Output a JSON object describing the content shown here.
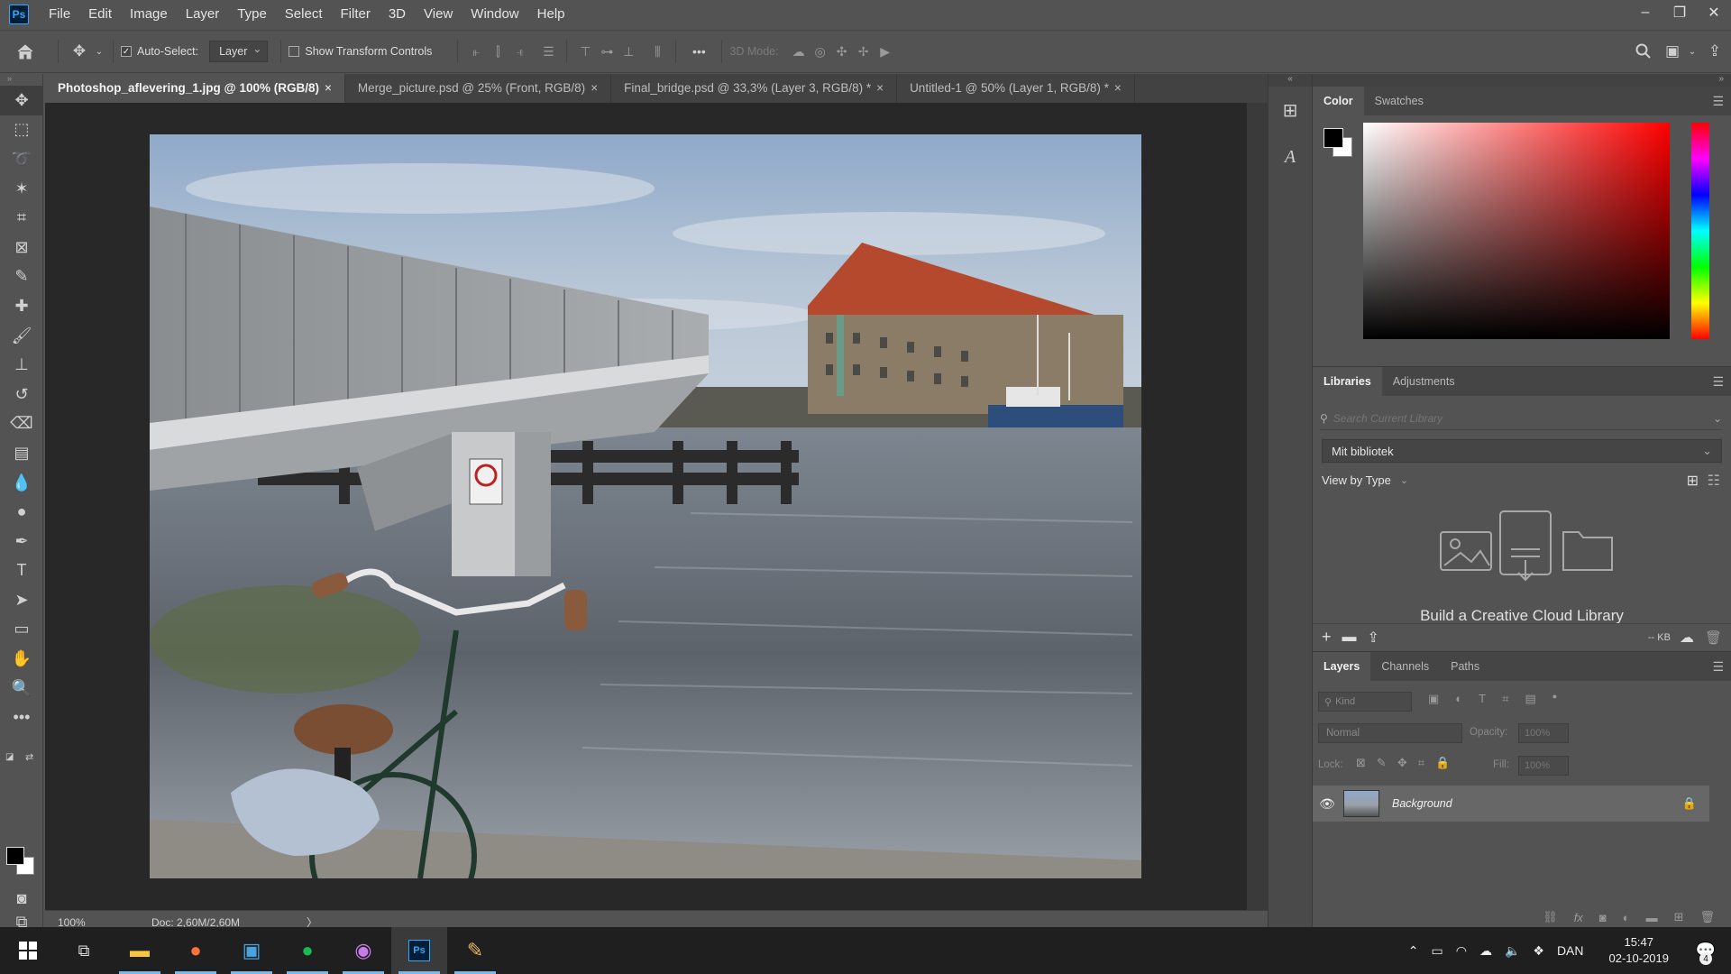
{
  "app": {
    "logo": "Ps"
  },
  "menu": [
    "File",
    "Edit",
    "Image",
    "Layer",
    "Type",
    "Select",
    "Filter",
    "3D",
    "View",
    "Window",
    "Help"
  ],
  "window_controls": {
    "minimize": "–",
    "restore": "❐",
    "close": "✕"
  },
  "options": {
    "auto_select_label": "Auto-Select:",
    "auto_select_checked": true,
    "layer_dropdown": "Layer",
    "transform_label": "Show Transform Controls",
    "mode_label": "3D Mode:",
    "more": "•••"
  },
  "tabs": [
    {
      "label": "Photoshop_aflevering_1.jpg @ 100% (RGB/8)",
      "active": true
    },
    {
      "label": "Merge_picture.psd @ 25% (Front, RGB/8)"
    },
    {
      "label": "Final_bridge.psd @ 33,3% (Layer 3, RGB/8) *"
    },
    {
      "label": "Untitled-1 @ 50% (Layer 1, RGB/8) *"
    }
  ],
  "status": {
    "zoom": "100%",
    "doc": "Doc: 2,60M/2,60M",
    "arrow": "〉"
  },
  "panels": {
    "color_tabs": [
      "Color",
      "Swatches"
    ],
    "lib_tabs": [
      "Libraries",
      "Adjustments"
    ],
    "lib_search_placeholder": "Search Current Library",
    "lib_selected": "Mit bibliotek",
    "view_by": "View by Type",
    "lib_build_text": "Build a Creative Cloud Library",
    "lib_size": "-- KB",
    "layer_tabs": [
      "Layers",
      "Channels",
      "Paths"
    ],
    "kind_placeholder": "Kind",
    "blend_mode": "Normal",
    "opacity_label": "Opacity:",
    "opacity_value": "100%",
    "lock_label": "Lock:",
    "fill_label": "Fill:",
    "fill_value": "100%",
    "layer_name": "Background"
  },
  "taskbar": {
    "language": "DAN",
    "time": "15:47",
    "date": "02-10-2019",
    "notification_count": "4"
  }
}
